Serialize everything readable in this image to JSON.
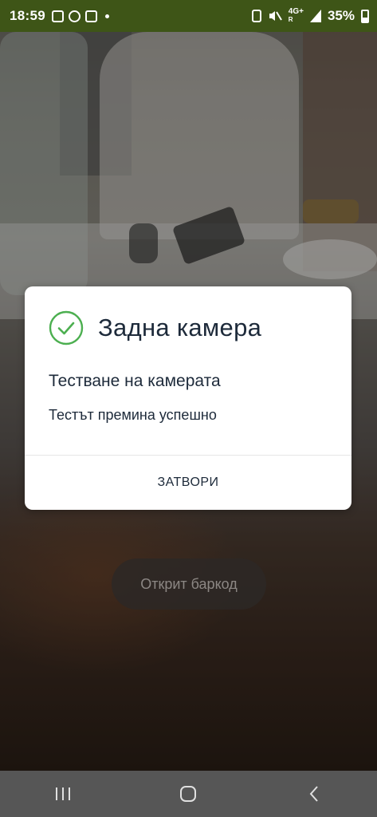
{
  "status_bar": {
    "time": "18:59",
    "network": "4G+",
    "network_sub": "R",
    "battery": "35%"
  },
  "dialog": {
    "title": "Задна камера",
    "subtitle": "Тестване на камерата",
    "message": "Тестът премина успешно",
    "close_label": "ЗАТВОРИ",
    "accent": "#4caf50"
  },
  "barcode_label": "Открит баркод",
  "nav": {
    "recents_icon": "recents-icon",
    "home_icon": "home-icon",
    "back_icon": "back-icon"
  }
}
